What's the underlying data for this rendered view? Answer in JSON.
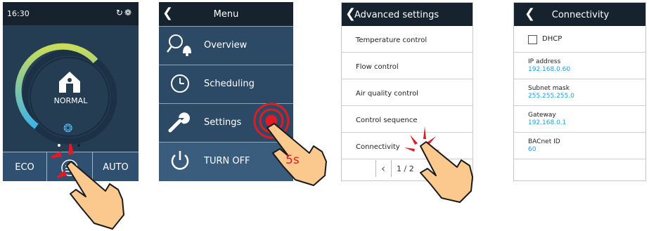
{
  "home": {
    "time": "16:30",
    "status_icons": "↻❁",
    "mode": "NORMAL",
    "fan_icon": "❂",
    "buttons": {
      "eco": "ECO",
      "auto": "AUTO"
    },
    "colors": {
      "bg": "#243d53",
      "gauge_start": "#c8dc5a",
      "gauge_end": "#3fb3e6"
    }
  },
  "menu": {
    "back": "❮",
    "title": "Menu",
    "items": [
      {
        "label": "Overview",
        "icon": "overview-icon"
      },
      {
        "label": "Scheduling",
        "icon": "clock-icon"
      },
      {
        "label": "Settings",
        "icon": "wrench-icon"
      },
      {
        "label": "TURN OFF",
        "icon": "power-icon"
      }
    ],
    "hold_hint": "5s"
  },
  "advanced": {
    "back": "❮",
    "title": "Advanced settings",
    "items": [
      "Temperature control",
      "Flow control",
      "Air quality control",
      "Control sequence",
      "Connectivity"
    ],
    "pager": {
      "prev": "‹",
      "page": "1 / 2"
    }
  },
  "connectivity": {
    "back": "❮",
    "title": "Connectivity",
    "dhcp_label": "DHCP",
    "fields": [
      {
        "label": "IP address",
        "value": "192.168.0.60"
      },
      {
        "label": "Subnet mask",
        "value": "255.255.255.0"
      },
      {
        "label": "Gateway",
        "value": "192.168.0.1"
      },
      {
        "label": "BACnet ID",
        "value": "60"
      }
    ],
    "accent": "#1aa3d9"
  }
}
